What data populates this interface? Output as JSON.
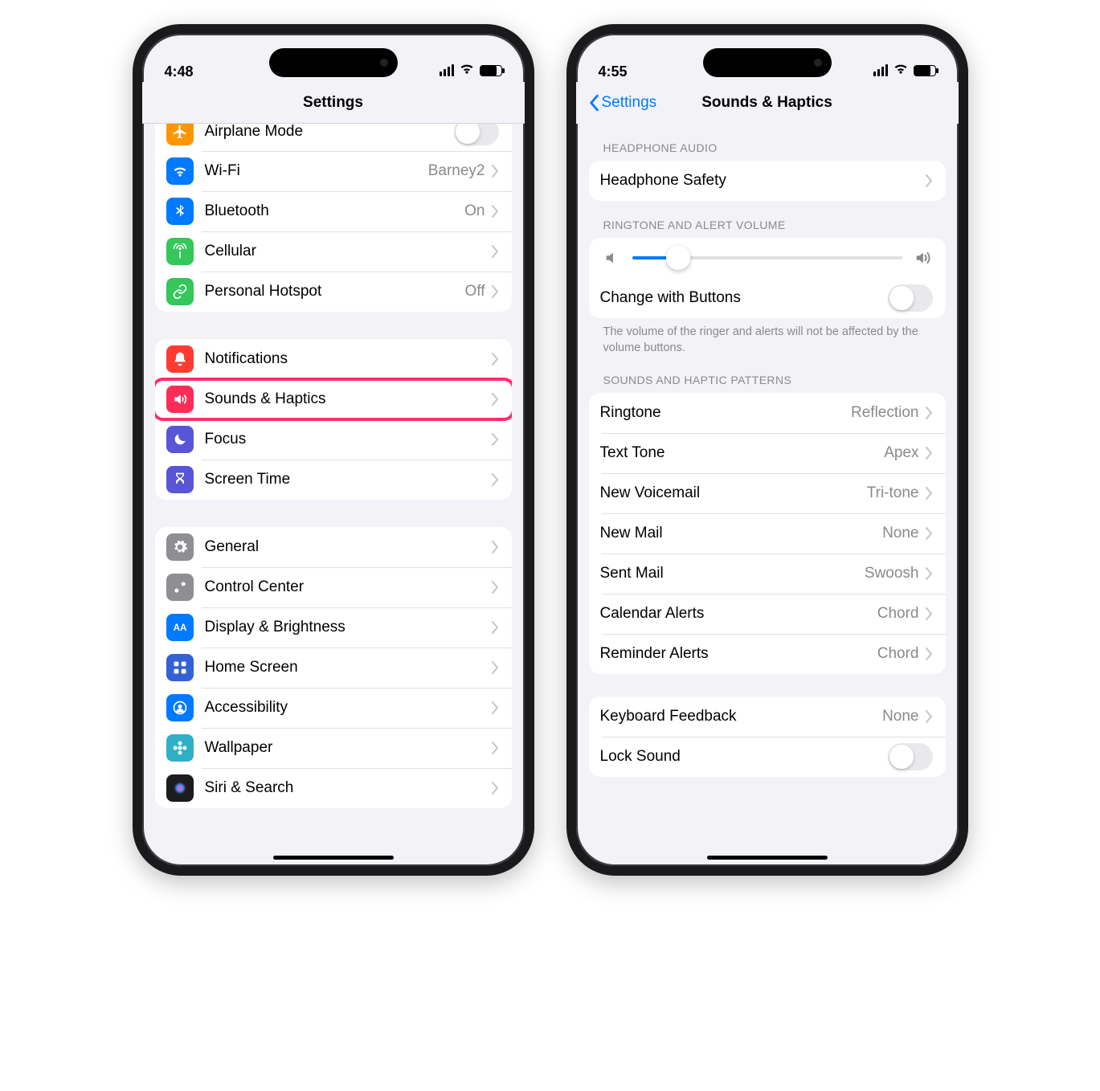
{
  "colors": {
    "orange": "#ff9500",
    "blue": "#007aff",
    "green": "#34c759",
    "red": "#ff3b30",
    "pink": "#ff2d55",
    "indigo": "#5856d6",
    "gray": "#8e8e93",
    "teal": "#30b0c7",
    "lightblue": "#5ac8fa",
    "cyan": "#32ade6"
  },
  "left": {
    "time": "4:48",
    "title": "Settings",
    "rows_g1": [
      {
        "icon": "airplane",
        "bg": "#ff9500",
        "label": "Airplane Mode",
        "toggle": false
      },
      {
        "icon": "wifi",
        "bg": "#007aff",
        "label": "Wi-Fi",
        "value": "Barney2"
      },
      {
        "icon": "bluetooth",
        "bg": "#007aff",
        "label": "Bluetooth",
        "value": "On"
      },
      {
        "icon": "antenna",
        "bg": "#34c759",
        "label": "Cellular"
      },
      {
        "icon": "link",
        "bg": "#34c759",
        "label": "Personal Hotspot",
        "value": "Off"
      }
    ],
    "rows_g2": [
      {
        "icon": "bell",
        "bg": "#ff3b30",
        "label": "Notifications"
      },
      {
        "icon": "speaker",
        "bg": "#ff2d55",
        "label": "Sounds & Haptics",
        "highlight": true
      },
      {
        "icon": "moon",
        "bg": "#5856d6",
        "label": "Focus"
      },
      {
        "icon": "hourglass",
        "bg": "#5856d6",
        "label": "Screen Time"
      }
    ],
    "rows_g3": [
      {
        "icon": "gear",
        "bg": "#8e8e93",
        "label": "General"
      },
      {
        "icon": "switches",
        "bg": "#8e8e93",
        "label": "Control Center"
      },
      {
        "icon": "aa",
        "bg": "#007aff",
        "label": "Display & Brightness"
      },
      {
        "icon": "grid",
        "bg": "#3561d6",
        "label": "Home Screen"
      },
      {
        "icon": "person",
        "bg": "#007aff",
        "label": "Accessibility"
      },
      {
        "icon": "flower",
        "bg": "#30b0c7",
        "label": "Wallpaper"
      },
      {
        "icon": "siri",
        "bg": "#1c1c1e",
        "label": "Siri & Search"
      }
    ]
  },
  "right": {
    "time": "4:55",
    "back": "Settings",
    "title": "Sounds & Haptics",
    "headphone_header": "HEADPHONE AUDIO",
    "headphone_row": "Headphone Safety",
    "volume_header": "RINGTONE AND ALERT VOLUME",
    "slider_pct": 17,
    "change_buttons": "Change with Buttons",
    "change_buttons_toggle": false,
    "volume_footer": "The volume of the ringer and alerts will not be affected by the volume buttons.",
    "patterns_header": "SOUNDS AND HAPTIC PATTERNS",
    "patterns": [
      {
        "label": "Ringtone",
        "value": "Reflection"
      },
      {
        "label": "Text Tone",
        "value": "Apex"
      },
      {
        "label": "New Voicemail",
        "value": "Tri-tone"
      },
      {
        "label": "New Mail",
        "value": "None"
      },
      {
        "label": "Sent Mail",
        "value": "Swoosh"
      },
      {
        "label": "Calendar Alerts",
        "value": "Chord"
      },
      {
        "label": "Reminder Alerts",
        "value": "Chord"
      }
    ],
    "kb_feedback_label": "Keyboard Feedback",
    "kb_feedback_value": "None",
    "lock_sound_label": "Lock Sound",
    "lock_sound_toggle": false
  }
}
